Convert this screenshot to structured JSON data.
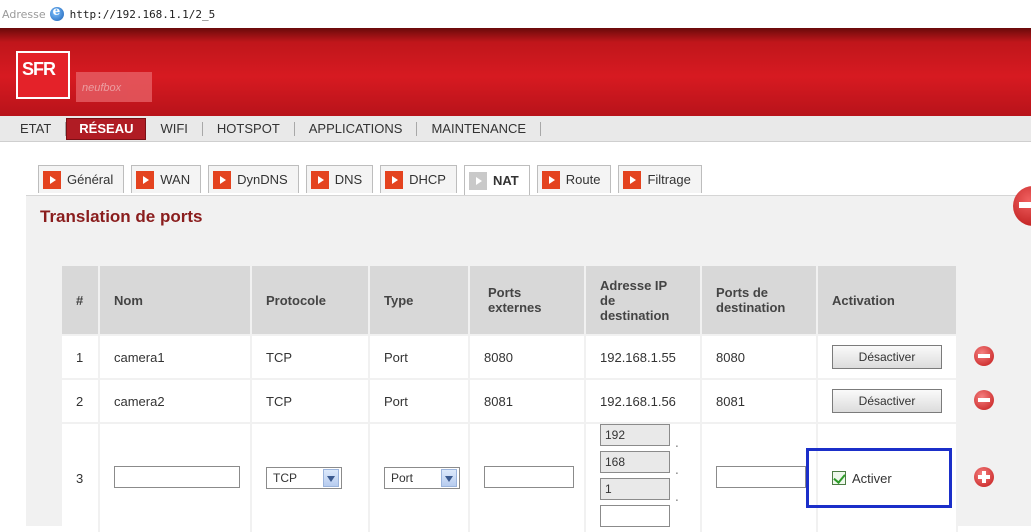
{
  "browser": {
    "address_label": "Adresse",
    "url": "http://192.168.1.1/2_5"
  },
  "brand": {
    "logo": "SFR",
    "sub": "neufbox"
  },
  "topnav": [
    "ETAT",
    "RÉSEAU",
    "WIFI",
    "HOTSPOT",
    "APPLICATIONS",
    "MAINTENANCE"
  ],
  "subtabs": [
    "Général",
    "WAN",
    "DynDNS",
    "DNS",
    "DHCP",
    "NAT",
    "Route",
    "Filtrage"
  ],
  "active_tab": "NAT",
  "section_title": "Translation de ports",
  "table": {
    "headers": [
      "#",
      "Nom",
      "Protocole",
      "Type",
      "Ports externes",
      "Adresse IP de destination",
      "Ports de destination",
      "Activation"
    ],
    "rows": [
      {
        "num": "1",
        "name": "camera1",
        "protocol": "TCP",
        "type": "Port",
        "ext_port": "8080",
        "dest_ip": "192.168.1.55",
        "dest_port": "8080",
        "action": "Désactiver"
      },
      {
        "num": "2",
        "name": "camera2",
        "protocol": "TCP",
        "type": "Port",
        "ext_port": "8081",
        "dest_ip": "192.168.1.56",
        "dest_port": "8081",
        "action": "Désactiver"
      }
    ],
    "new_row": {
      "num": "3",
      "protocol": "TCP",
      "type": "Port",
      "ip_parts": [
        "192",
        "168",
        "1",
        ""
      ],
      "activate_label": "Activer",
      "activate_checked": true
    }
  },
  "colors": {
    "header_red": "#d71a21",
    "title_red": "#8a1d1d",
    "highlight_blue": "#1b2fc9"
  }
}
